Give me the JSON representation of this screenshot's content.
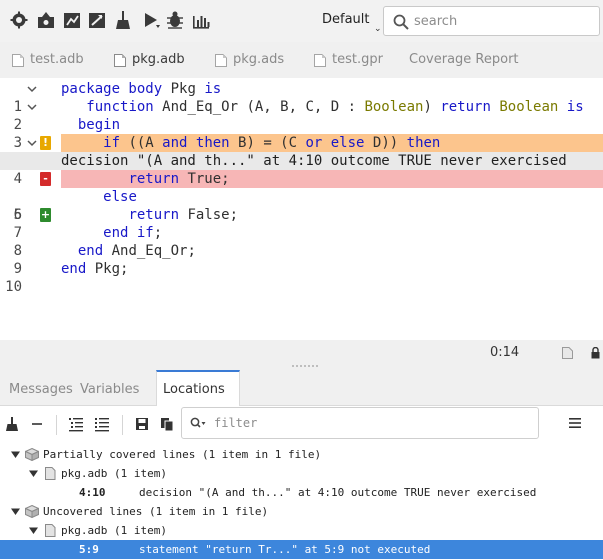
{
  "toolbar": {
    "icons": [
      "build-icon",
      "build-and-install-icon",
      "build-main-icon",
      "build-all-icon",
      "clean-icon",
      "run-icon",
      "debug-icon",
      "analyze-icon"
    ],
    "perspective": "Default",
    "search_placeholder": "search"
  },
  "editor_tabs": [
    {
      "label": "test.adb",
      "active": false
    },
    {
      "label": "pkg.adb",
      "active": true
    },
    {
      "label": "pkg.ads",
      "active": false
    },
    {
      "label": "test.gpr",
      "active": false
    },
    {
      "label": "Coverage Report",
      "active": false
    }
  ],
  "editor": {
    "lines": [
      {
        "num": "1",
        "text": "package body Pkg is"
      },
      {
        "num": "2",
        "text": "   function And_Eq_Or (A, B, C, D : Boolean) return Boolean is"
      },
      {
        "num": "3",
        "text": "  begin"
      },
      {
        "num": "4",
        "text": "     if ((A and then B) = (C or else D)) then"
      },
      {
        "num": "",
        "text": "decision \"(A and th...\" at 4:10 outcome TRUE never exercised"
      },
      {
        "num": "5",
        "text": "        return True;"
      },
      {
        "num": "6",
        "text": "     else"
      },
      {
        "num": "7",
        "text": "        return False;"
      },
      {
        "num": "8",
        "text": "     end if;"
      },
      {
        "num": "9",
        "text": "  end And_Eq_Or;"
      },
      {
        "num": "10",
        "text": "end Pkg;"
      }
    ],
    "markers": {
      "warn": "!",
      "minus": "-",
      "plus": "+"
    }
  },
  "status": {
    "cursor": "0:14"
  },
  "panel_tabs": [
    {
      "label": "Messages",
      "active": false
    },
    {
      "label": "Variables",
      "active": false
    },
    {
      "label": "Locations",
      "active": true
    }
  ],
  "locations": {
    "filter_placeholder": "filter",
    "categories": [
      {
        "title": "Partially covered lines (1 item in 1 file)",
        "file": "pkg.adb (1 item)",
        "items": [
          {
            "loc": "4:10",
            "message": "decision \"(A and th...\" at 4:10 outcome TRUE never exercised",
            "selected": false
          }
        ]
      },
      {
        "title": "Uncovered lines (1 item in 1 file)",
        "file": "pkg.adb (1 item)",
        "items": [
          {
            "loc": "5:9",
            "message": "statement \"return Tr...\" at 5:9 not executed",
            "selected": true
          }
        ]
      }
    ]
  }
}
